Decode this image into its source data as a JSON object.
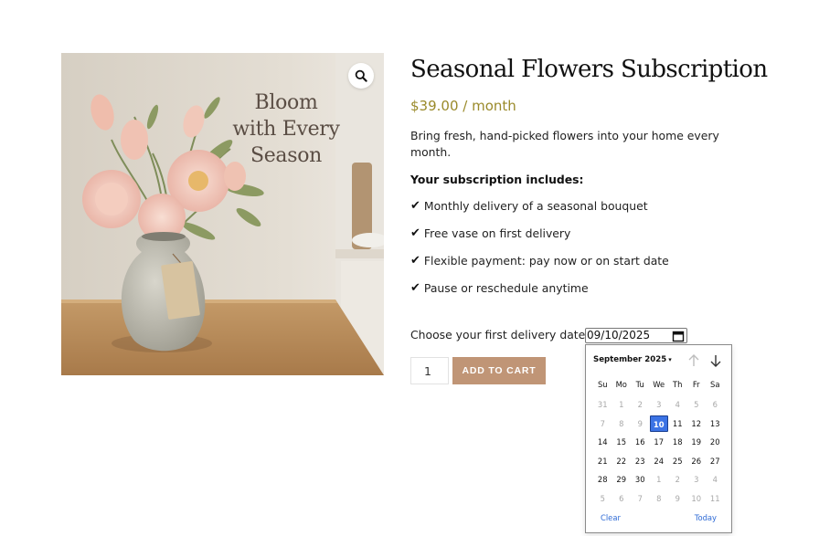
{
  "product": {
    "image_headline": [
      "Bloom",
      "with Every",
      "Season"
    ],
    "zoom_icon": "magnifier-icon",
    "title": "Seasonal Flowers Subscription",
    "price": "$39.00",
    "price_period": " / month",
    "description": "Bring fresh, hand-picked flowers into your home every month.",
    "includes_heading": "Your subscription includes:",
    "check_glyph": "✔",
    "features": [
      "Monthly delivery of a seasonal bouquet",
      "Free vase on first delivery",
      "Flexible payment: pay now or on start date",
      "Pause or reschedule anytime"
    ]
  },
  "delivery": {
    "label": "Choose your first delivery date:",
    "value": "09/10/2025",
    "calendar_icon": "calendar-icon"
  },
  "cart": {
    "quantity": "1",
    "button_label": "ADD TO CART",
    "button_color": "#c09576"
  },
  "datepicker": {
    "month_label": "September 2025",
    "caret": "▾",
    "up_icon": "arrow-up-icon",
    "down_icon": "arrow-down-icon",
    "weekdays": [
      "Su",
      "Mo",
      "Tu",
      "We",
      "Th",
      "Fr",
      "Sa"
    ],
    "weeks": [
      [
        {
          "d": "31",
          "m": true
        },
        {
          "d": "1",
          "m": true
        },
        {
          "d": "2",
          "m": true
        },
        {
          "d": "3",
          "m": true
        },
        {
          "d": "4",
          "m": true
        },
        {
          "d": "5",
          "m": true
        },
        {
          "d": "6",
          "m": true
        }
      ],
      [
        {
          "d": "7",
          "m": true
        },
        {
          "d": "8",
          "m": true
        },
        {
          "d": "9",
          "m": true
        },
        {
          "d": "10",
          "s": true
        },
        {
          "d": "11"
        },
        {
          "d": "12"
        },
        {
          "d": "13"
        }
      ],
      [
        {
          "d": "14"
        },
        {
          "d": "15"
        },
        {
          "d": "16"
        },
        {
          "d": "17"
        },
        {
          "d": "18"
        },
        {
          "d": "19"
        },
        {
          "d": "20"
        }
      ],
      [
        {
          "d": "21"
        },
        {
          "d": "22"
        },
        {
          "d": "23"
        },
        {
          "d": "24"
        },
        {
          "d": "25"
        },
        {
          "d": "26"
        },
        {
          "d": "27"
        }
      ],
      [
        {
          "d": "28"
        },
        {
          "d": "29"
        },
        {
          "d": "30"
        },
        {
          "d": "1",
          "m": true
        },
        {
          "d": "2",
          "m": true
        },
        {
          "d": "3",
          "m": true
        },
        {
          "d": "4",
          "m": true
        }
      ],
      [
        {
          "d": "5",
          "m": true
        },
        {
          "d": "6",
          "m": true
        },
        {
          "d": "7",
          "m": true
        },
        {
          "d": "8",
          "m": true
        },
        {
          "d": "9",
          "m": true
        },
        {
          "d": "10",
          "m": true
        },
        {
          "d": "11",
          "m": true
        }
      ]
    ],
    "clear_label": "Clear",
    "today_label": "Today",
    "selected_color": "#3b73e5"
  },
  "colors": {
    "price": "#9a8a2a",
    "link": "#2f6bd6"
  }
}
